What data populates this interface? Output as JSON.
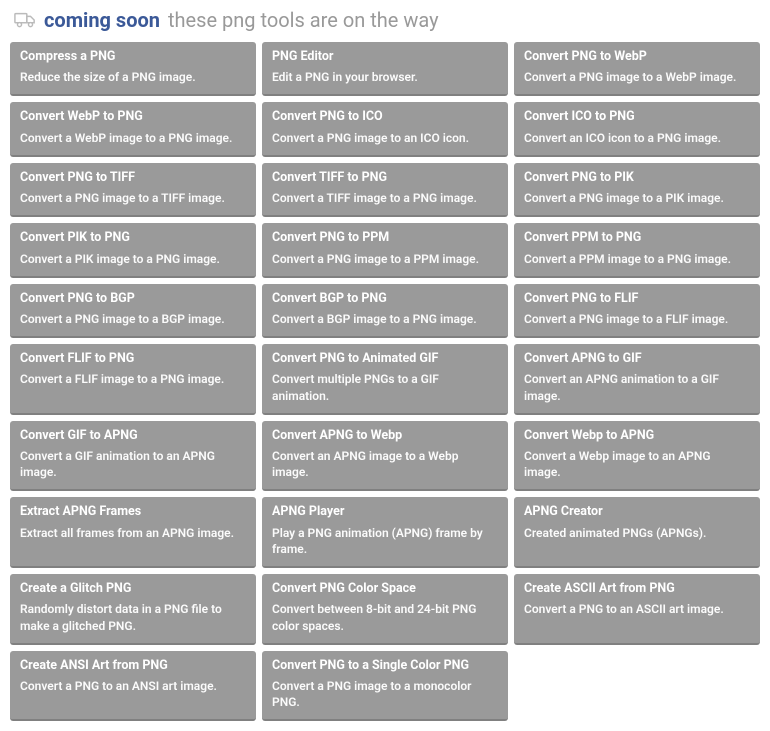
{
  "header": {
    "title": "coming soon",
    "subtitle": "these png tools are on the way"
  },
  "tools": [
    {
      "title": "Compress a PNG",
      "desc": "Reduce the size of a PNG image."
    },
    {
      "title": "PNG Editor",
      "desc": "Edit a PNG in your browser."
    },
    {
      "title": "Convert PNG to WebP",
      "desc": "Convert a PNG image to a WebP image."
    },
    {
      "title": "Convert WebP to PNG",
      "desc": "Convert a WebP image to a PNG image."
    },
    {
      "title": "Convert PNG to ICO",
      "desc": "Convert a PNG image to an ICO icon."
    },
    {
      "title": "Convert ICO to PNG",
      "desc": "Convert an ICO icon to a PNG image."
    },
    {
      "title": "Convert PNG to TIFF",
      "desc": "Convert a PNG image to a TIFF image."
    },
    {
      "title": "Convert TIFF to PNG",
      "desc": "Convert a TIFF image to a PNG image."
    },
    {
      "title": "Convert PNG to PIK",
      "desc": "Convert a PNG image to a PIK image."
    },
    {
      "title": "Convert PIK to PNG",
      "desc": "Convert a PIK image to a PNG image."
    },
    {
      "title": "Convert PNG to PPM",
      "desc": "Convert a PNG image to a PPM image."
    },
    {
      "title": "Convert PPM to PNG",
      "desc": "Convert a PPM image to a PNG image."
    },
    {
      "title": "Convert PNG to BGP",
      "desc": "Convert a PNG image to a BGP image."
    },
    {
      "title": "Convert BGP to PNG",
      "desc": "Convert a BGP image to a PNG image."
    },
    {
      "title": "Convert PNG to FLIF",
      "desc": "Convert a PNG image to a FLIF image."
    },
    {
      "title": "Convert FLIF to PNG",
      "desc": "Convert a FLIF image to a PNG image."
    },
    {
      "title": "Convert PNG to Animated GIF",
      "desc": "Convert multiple PNGs to a GIF animation."
    },
    {
      "title": "Convert APNG to GIF",
      "desc": "Convert an APNG animation to a GIF image."
    },
    {
      "title": "Convert GIF to APNG",
      "desc": "Convert a GIF animation to an APNG image."
    },
    {
      "title": "Convert APNG to Webp",
      "desc": "Convert an APNG image to a Webp image."
    },
    {
      "title": "Convert Webp to APNG",
      "desc": "Convert a Webp image to an APNG image."
    },
    {
      "title": "Extract APNG Frames",
      "desc": "Extract all frames from an APNG image."
    },
    {
      "title": "APNG Player",
      "desc": "Play a PNG animation (APNG) frame by frame."
    },
    {
      "title": "APNG Creator",
      "desc": "Created animated PNGs (APNGs)."
    },
    {
      "title": "Create a Glitch PNG",
      "desc": "Randomly distort data in a PNG file to make a glitched PNG."
    },
    {
      "title": "Convert PNG Color Space",
      "desc": "Convert between 8-bit and 24-bit PNG color spaces."
    },
    {
      "title": "Create ASCII Art from PNG",
      "desc": "Convert a PNG to an ASCII art image."
    },
    {
      "title": "Create ANSI Art from PNG",
      "desc": "Convert a PNG to an ANSI art image."
    },
    {
      "title": "Convert PNG to a Single Color PNG",
      "desc": "Convert a PNG image to a monocolor PNG."
    }
  ]
}
